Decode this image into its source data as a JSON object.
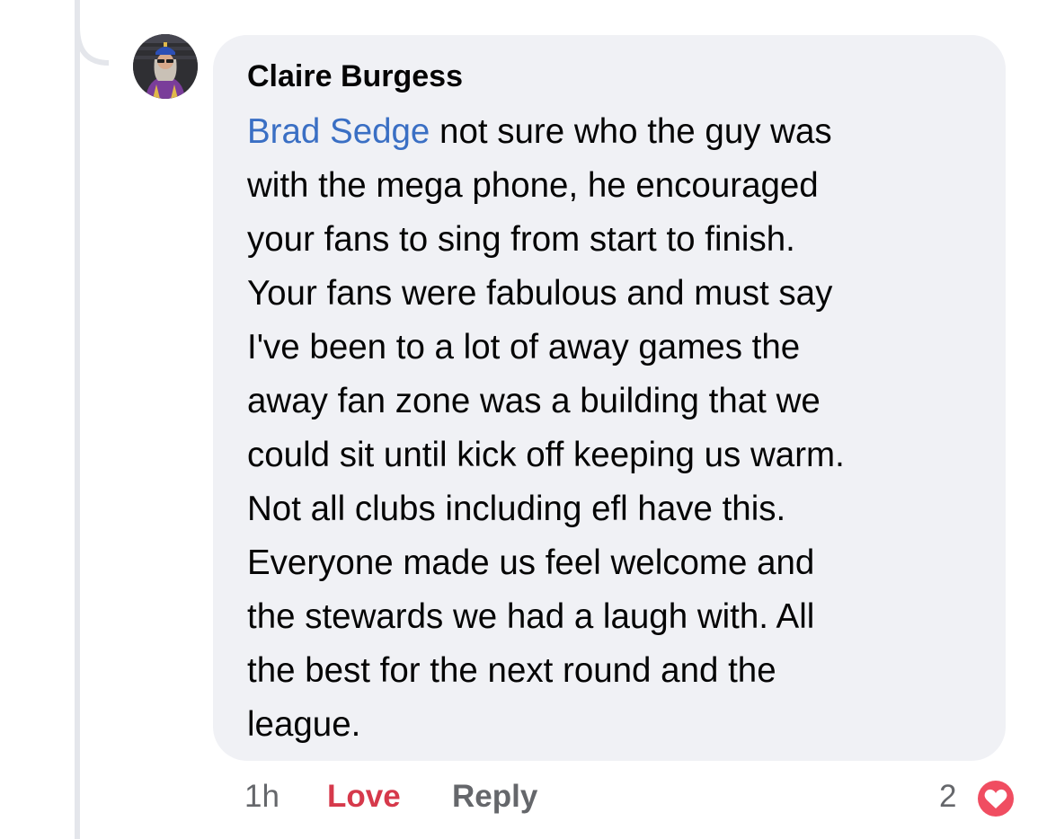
{
  "comment": {
    "author": "Claire Burgess",
    "mention": "Brad Sedge",
    "first_line_rest": " not sure who the guy was",
    "lines": [
      "with the mega phone, he encouraged",
      "your fans to sing from start to finish.",
      "Your fans were fabulous and must say",
      "I've been to a lot of away games the",
      "away fan zone was a building that we",
      "could sit until kick off keeping us warm.",
      "Not all clubs including efl have this.",
      "Everyone made us feel welcome and",
      "the stewards we had a laugh with. All",
      "the best for the next round and the",
      "league."
    ]
  },
  "actions": {
    "timestamp": "1h",
    "love_label": "Love",
    "reply_label": "Reply",
    "reaction_count": "2"
  },
  "reaction_icon": "heart-icon",
  "colors": {
    "bubble": "#f0f1f5",
    "mention": "#3a6fc4",
    "love": "#d6394b",
    "heart_badge": "#f04d61",
    "muted": "#65676b"
  }
}
